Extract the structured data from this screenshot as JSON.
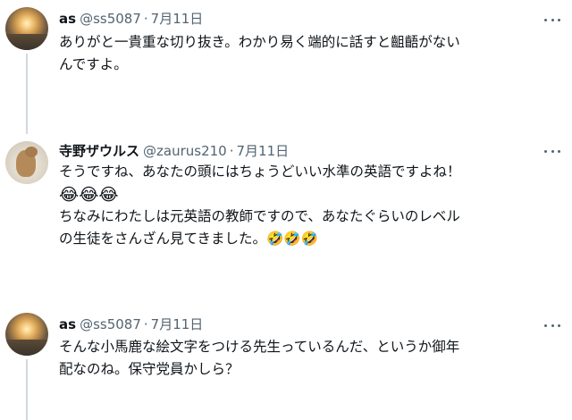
{
  "tweets": [
    {
      "name": "as",
      "handle": "@ss5087",
      "sep": "·",
      "date": "7月11日",
      "lines": [
        "ありがと一貴重な切り抜き。わかり易く端的に話すと齟齬がない",
        "んですよ。"
      ]
    },
    {
      "name": "寺野ザウルス",
      "handle": "@zaurus210",
      "sep": "·",
      "date": "7月11日",
      "lines": [
        "そうですね、あなたの頭にはちょうどいい水準の英語ですよね！",
        "😂😂😂",
        "ちなみにわたしは元英語の教師ですので、あなたぐらいのレベル",
        "の生徒をさんざん見てきました。🤣🤣🤣"
      ]
    },
    {
      "name": "as",
      "handle": "@ss5087",
      "sep": "·",
      "date": "7月11日",
      "lines": [
        "そんな小馬鹿な絵文字をつける先生っているんだ、というか御年",
        "配なのね。保守党員かしら？"
      ]
    }
  ]
}
